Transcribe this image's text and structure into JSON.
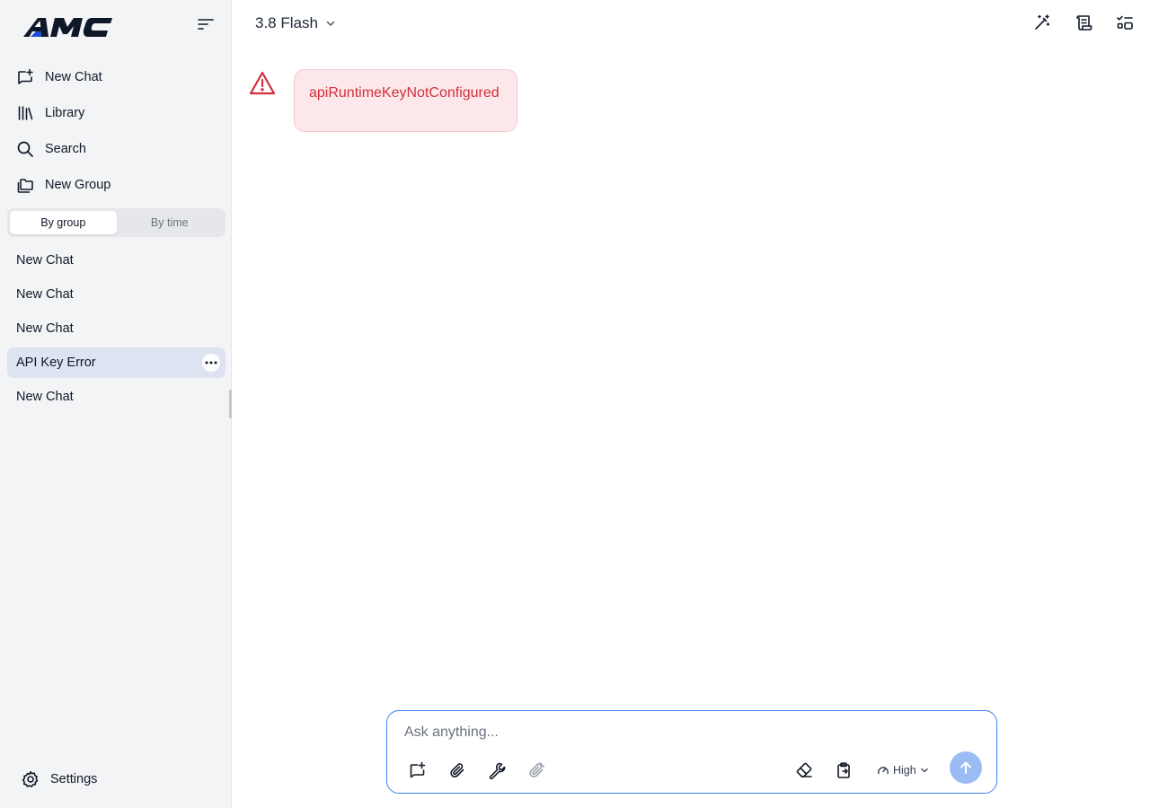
{
  "sidebar": {
    "logo_text": "AMC",
    "nav": [
      {
        "label": "New Chat",
        "icon": "new-chat-icon"
      },
      {
        "label": "Library",
        "icon": "library-icon"
      },
      {
        "label": "Search",
        "icon": "search-icon"
      },
      {
        "label": "New Group",
        "icon": "folders-icon"
      }
    ],
    "view_toggle": {
      "options": [
        "By group",
        "By time"
      ],
      "selected": "By group"
    },
    "chats": [
      {
        "title": "New Chat",
        "active": false
      },
      {
        "title": "New Chat",
        "active": false
      },
      {
        "title": "New Chat",
        "active": false
      },
      {
        "title": "API Key Error",
        "active": true
      },
      {
        "title": "New Chat",
        "active": false
      }
    ],
    "settings_label": "Settings"
  },
  "header": {
    "model_name": "3.8 Flash",
    "icons": [
      "magic-wand-icon",
      "scroll-icon",
      "checklist-icon"
    ]
  },
  "messages": [
    {
      "type": "error",
      "text": "apiRuntimeKeyNotConfigured",
      "icon": "warning-icon"
    }
  ],
  "composer": {
    "placeholder": "Ask anything...",
    "value": "",
    "tools": [
      "new-topic-icon",
      "paperclip-icon",
      "wrench-icon",
      "attachment-disabled-icon"
    ],
    "right_tools": [
      "eraser-icon",
      "clipboard-icon"
    ],
    "effort_label": "High",
    "send_icon": "arrow-up-icon"
  },
  "colors": {
    "accent": "#3b82f6",
    "send_button": "#9bbbf5",
    "error_text": "#d32f3e",
    "error_bg": "#fce8ea",
    "sidebar_bg": "#f3f4f6",
    "active_chat_bg": "#dde3f0"
  }
}
